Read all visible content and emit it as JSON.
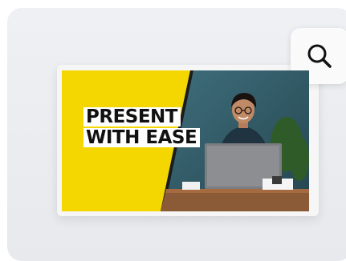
{
  "card": {
    "headline_line1": "PRESENT",
    "headline_line2": "WITH EASE",
    "accent_color": "#f4d700"
  },
  "actions": {
    "search_icon": "search-icon"
  }
}
